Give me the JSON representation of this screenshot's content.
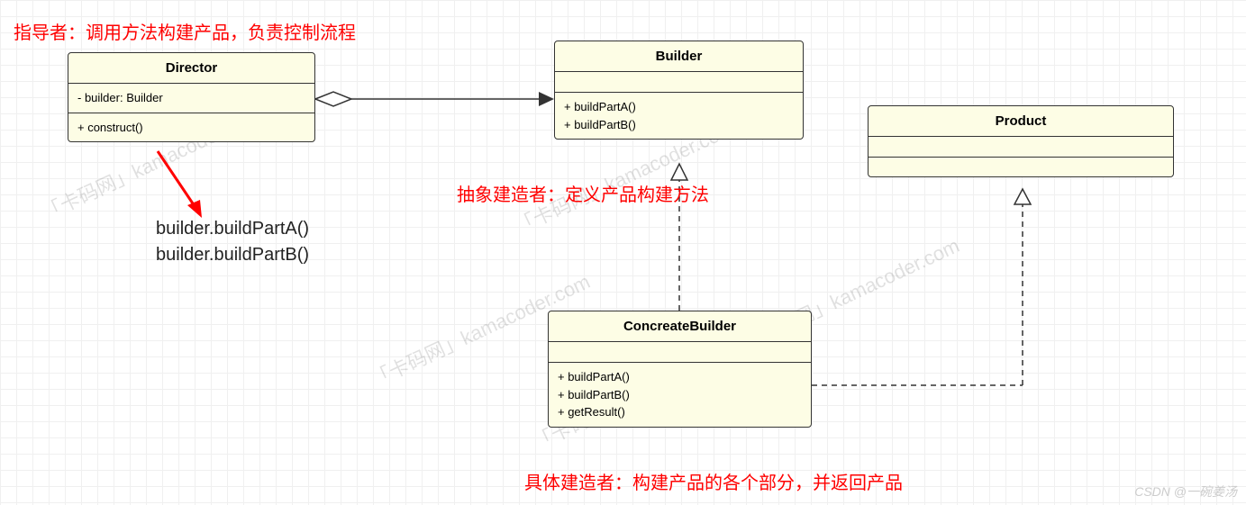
{
  "annotations": {
    "director_note": "指导者：调用方法构建产品，负责控制流程",
    "builder_note": "抽象建造者：定义产品构建方法",
    "concrete_note": "具体建造者：构建产品的各个部分，并返回产品"
  },
  "calls": {
    "line1": "builder.buildPartA()",
    "line2": "builder.buildPartB()"
  },
  "classes": {
    "director": {
      "name": "Director",
      "attrs": [
        "- builder: Builder"
      ],
      "methods": [
        "+ construct()"
      ]
    },
    "builder": {
      "name": "Builder",
      "methods": [
        "+ buildPartA()",
        "+ buildPartB()"
      ]
    },
    "product": {
      "name": "Product"
    },
    "concrete": {
      "name": "ConcreateBuilder",
      "methods": [
        "+ buildPartA()",
        "+ buildPartB()",
        "+ getResult()"
      ]
    }
  },
  "watermark_text": "「卡码网」kamacoder.com",
  "credit": "CSDN @一碗姜汤"
}
